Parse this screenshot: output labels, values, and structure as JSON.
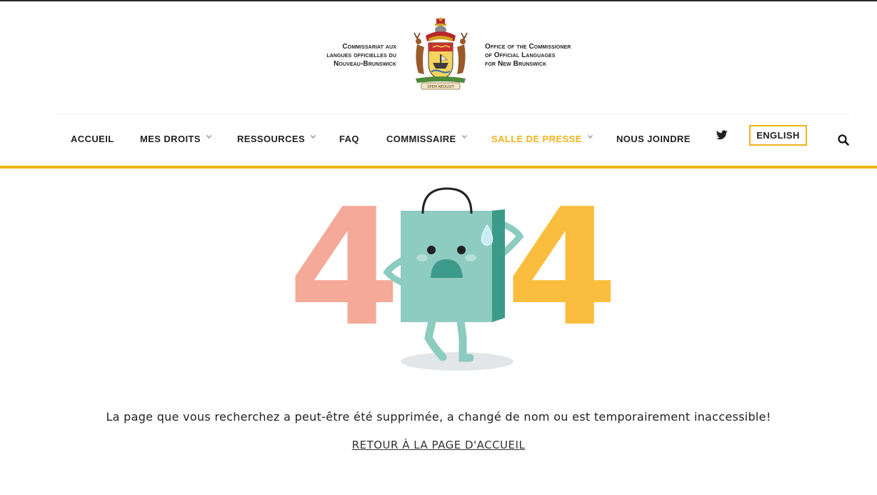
{
  "brand": {
    "fr_lines": [
      "Commissariat aux",
      "langues officielles du",
      "Nouveau-Brunswick"
    ],
    "en_lines": [
      "Office of the Commissioner",
      "of Official Languages",
      "for New Brunswick"
    ],
    "crest_motto": "SPEM REDUXIT"
  },
  "nav": {
    "items": [
      {
        "label": "ACCUEIL"
      },
      {
        "label": "MES DROITS"
      },
      {
        "label": "RESSOURCES"
      },
      {
        "label": "FAQ"
      },
      {
        "label": "COMMISSAIRE"
      },
      {
        "label": "SALLE DE PRESSE"
      },
      {
        "label": "NOUS JOINDRE"
      }
    ],
    "language_button": "ENGLISH",
    "accent_color": "#f0b31e"
  },
  "error": {
    "digits": [
      "4",
      "4"
    ],
    "message": "La page que vous recherchez a peut-être été supprimée, a changé de nom ou est temporairement inaccessible!",
    "home_link": "RETOUR À LA PAGE D'ACCUEIL"
  },
  "icons": {
    "twitter": "twitter-icon",
    "search": "search-icon",
    "crest": "coat-of-arms-icon"
  }
}
